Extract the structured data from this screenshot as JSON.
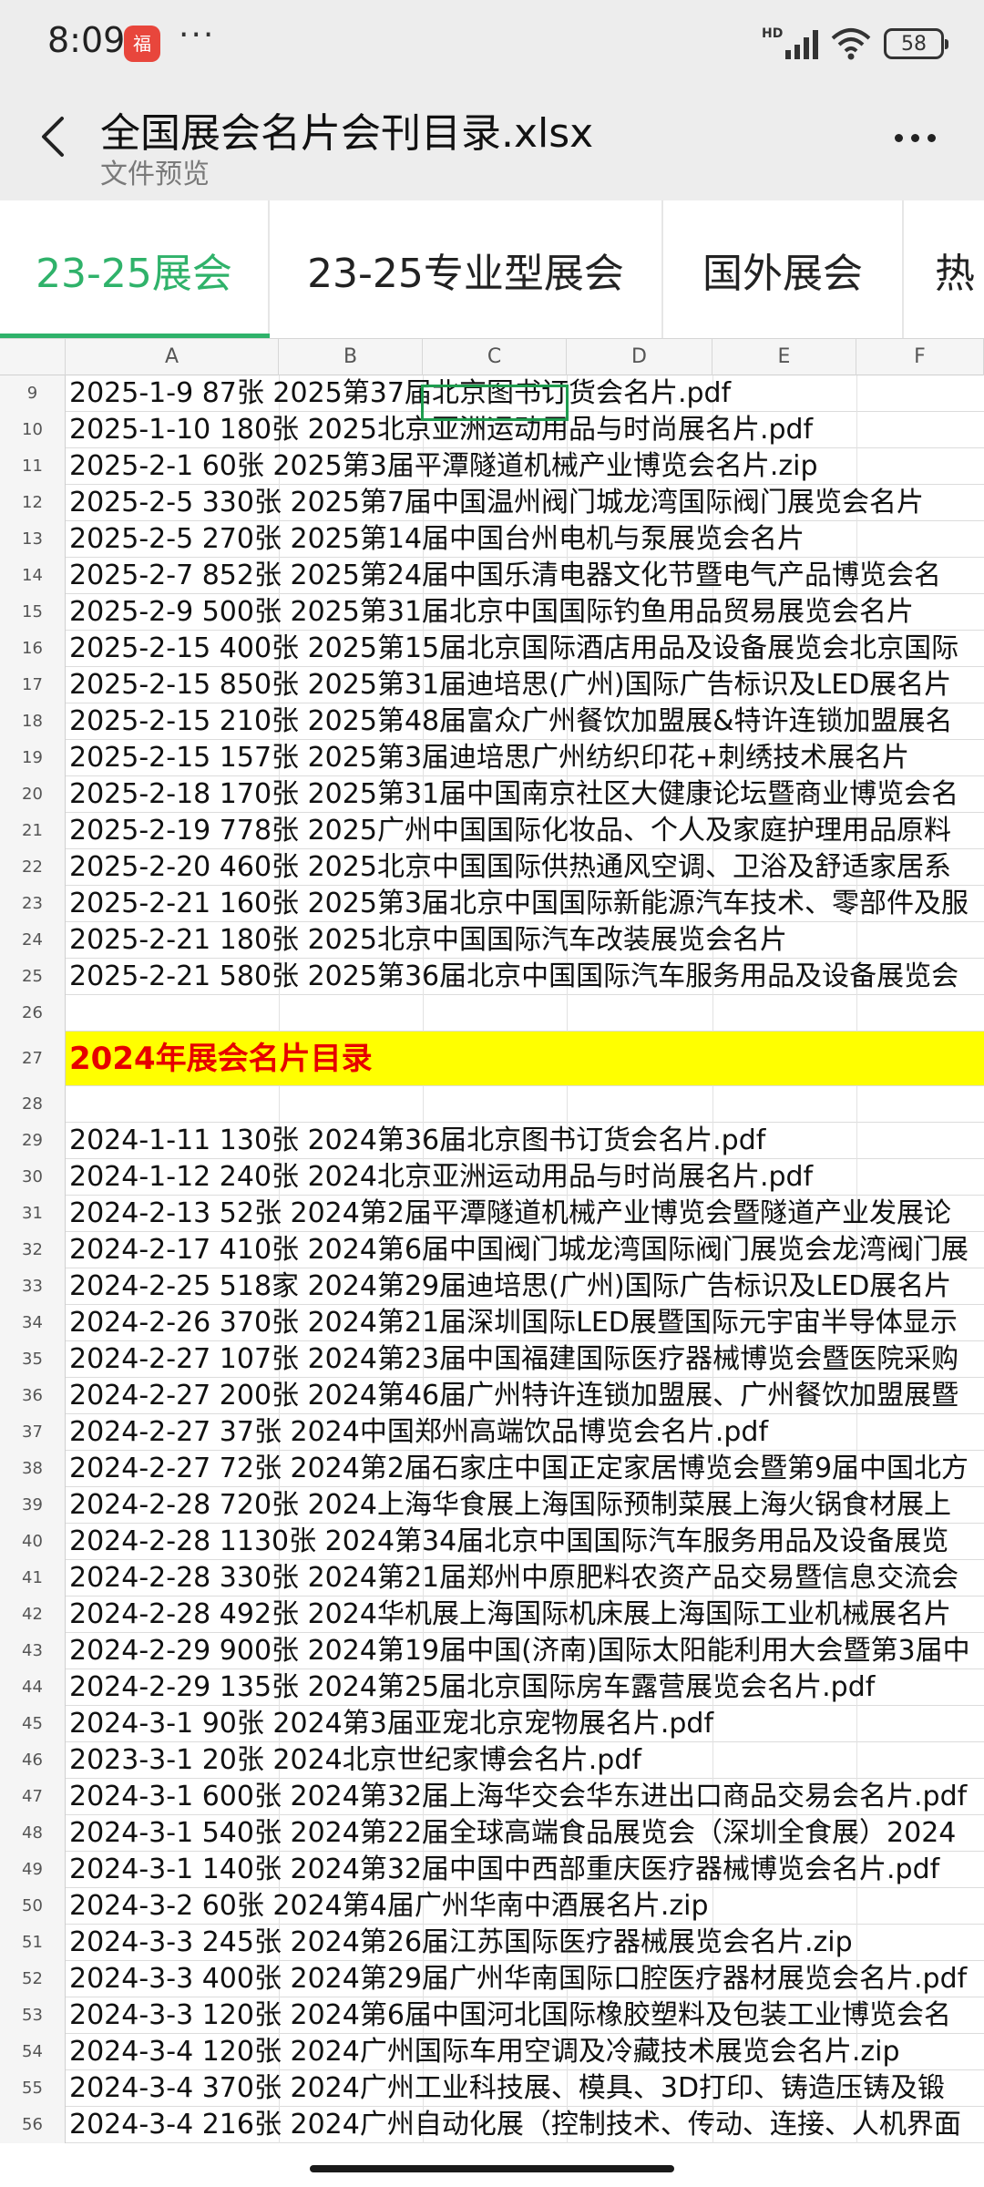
{
  "status": {
    "time": "8:09",
    "app_badge": "福",
    "dots": "···",
    "hd": "HD",
    "battery": "58"
  },
  "header": {
    "title": "全国展会名片会刊目录.xlsx",
    "subtitle": "文件预览"
  },
  "tabs": [
    {
      "label": "23-25展会",
      "active": true
    },
    {
      "label": "23-25专业型展会"
    },
    {
      "label": "国外展会"
    },
    {
      "label": "热"
    }
  ],
  "columns": [
    "A",
    "B",
    "C",
    "D",
    "E",
    "F"
  ],
  "rows": [
    {
      "n": "9",
      "text": "2025-1-9 87张 2025第37届北京图书订货会名片.pdf"
    },
    {
      "n": "10",
      "text": "2025-1-10 180张 2025北京亚洲运动用品与时尚展名片.pdf"
    },
    {
      "n": "11",
      "text": "2025-2-1 60张 2025第3届平潭隧道机械产业博览会名片.zip"
    },
    {
      "n": "12",
      "text": "2025-2-5 330张 2025第7届中国温州阀门城龙湾国际阀门展览会名片"
    },
    {
      "n": "13",
      "text": "2025-2-5 270张 2025第14届中国台州电机与泵展览会名片"
    },
    {
      "n": "14",
      "text": "2025-2-7 852张 2025第24届中国乐清电器文化节暨电气产品博览会名"
    },
    {
      "n": "15",
      "text": "2025-2-9 500张 2025第31届北京中国国际钓鱼用品贸易展览会名片"
    },
    {
      "n": "16",
      "text": "2025-2-15 400张 2025第15届北京国际酒店用品及设备展览会北京国际"
    },
    {
      "n": "17",
      "text": "2025-2-15 850张 2025第31届迪培思(广州)国际广告标识及LED展名片"
    },
    {
      "n": "18",
      "text": "2025-2-15 210张 2025第48届富众广州餐饮加盟展&特许连锁加盟展名"
    },
    {
      "n": "19",
      "text": "2025-2-15 157张 2025第3届迪培思广州纺织印花+刺绣技术展名片"
    },
    {
      "n": "20",
      "text": "2025-2-18 170张 2025第31届中国南京社区大健康论坛暨商业博览会名"
    },
    {
      "n": "21",
      "text": "2025-2-19 778张 2025广州中国国际化妆品、个人及家庭护理用品原料"
    },
    {
      "n": "22",
      "text": "2025-2-20 460张 2025北京中国国际供热通风空调、卫浴及舒适家居系"
    },
    {
      "n": "23",
      "text": "2025-2-21 160张 2025第3届北京中国国际新能源汽车技术、零部件及服"
    },
    {
      "n": "24",
      "text": "2025-2-21 180张 2025北京中国国际汽车改装展览会名片"
    },
    {
      "n": "25",
      "text": "2025-2-21 580张 2025第36届北京中国国际汽车服务用品及设备展览会"
    },
    {
      "n": "26",
      "text": ""
    },
    {
      "n": "27",
      "text": "2024年展会名片目录",
      "highlight": true
    },
    {
      "n": "28",
      "text": ""
    },
    {
      "n": "29",
      "text": "2024-1-11 130张 2024第36届北京图书订货会名片.pdf"
    },
    {
      "n": "30",
      "text": "2024-1-12 240张 2024北京亚洲运动用品与时尚展名片.pdf"
    },
    {
      "n": "31",
      "text": "2024-2-13 52张 2024第2届平潭隧道机械产业博览会暨隧道产业发展论"
    },
    {
      "n": "32",
      "text": "2024-2-17 410张 2024第6届中国阀门城龙湾国际阀门展览会龙湾阀门展"
    },
    {
      "n": "33",
      "text": "2024-2-25 518家 2024第29届迪培思(广州)国际广告标识及LED展名片"
    },
    {
      "n": "34",
      "text": "2024-2-26 370张 2024第21届深圳国际LED展暨国际元宇宙半导体显示"
    },
    {
      "n": "35",
      "text": "2024-2-27 107张 2024第23届中国福建国际医疗器械博览会暨医院采购"
    },
    {
      "n": "36",
      "text": "2024-2-27 200张 2024第46届广州特许连锁加盟展、广州餐饮加盟展暨"
    },
    {
      "n": "37",
      "text": "2024-2-27 37张 2024中国郑州高端饮品博览会名片.pdf"
    },
    {
      "n": "38",
      "text": "2024-2-27 72张 2024第2届石家庄中国正定家居博览会暨第9届中国北方"
    },
    {
      "n": "39",
      "text": "2024-2-28 720张 2024上海华食展上海国际预制菜展上海火锅食材展上"
    },
    {
      "n": "40",
      "text": "2024-2-28 1130张 2024第34届北京中国国际汽车服务用品及设备展览"
    },
    {
      "n": "41",
      "text": "2024-2-28 330张 2024第21届郑州中原肥料农资产品交易暨信息交流会"
    },
    {
      "n": "42",
      "text": "2024-2-28 492张 2024华机展上海国际机床展上海国际工业机械展名片"
    },
    {
      "n": "43",
      "text": "2024-2-29 900张 2024第19届中国(济南)国际太阳能利用大会暨第3届中"
    },
    {
      "n": "44",
      "text": "2024-2-29 135张 2024第25届北京国际房车露营展览会名片.pdf"
    },
    {
      "n": "45",
      "text": "2024-3-1 90张 2024第3届亚宠北京宠物展名片.pdf"
    },
    {
      "n": "46",
      "text": "2023-3-1 20张 2024北京世纪家博会名片.pdf"
    },
    {
      "n": "47",
      "text": "2024-3-1 600张 2024第32届上海华交会华东进出口商品交易会名片.pdf"
    },
    {
      "n": "48",
      "text": "2024-3-1 540张 2024第22届全球高端食品展览会（深圳全食展）2024"
    },
    {
      "n": "49",
      "text": "2024-3-1 140张 2024第32届中国中西部重庆医疗器械博览会名片.pdf"
    },
    {
      "n": "50",
      "text": "2024-3-2 60张 2024第4届广州华南中酒展名片.zip"
    },
    {
      "n": "51",
      "text": "2024-3-3 245张 2024第26届江苏国际医疗器械展览会名片.zip"
    },
    {
      "n": "52",
      "text": "2024-3-3 400张 2024第29届广州华南国际口腔医疗器材展览会名片.pdf"
    },
    {
      "n": "53",
      "text": "2024-3-3 120张 2024第6届中国河北国际橡胶塑料及包装工业博览会名"
    },
    {
      "n": "54",
      "text": "2024-3-4 120张 2024广州国际车用空调及冷藏技术展览会名片.zip"
    },
    {
      "n": "55",
      "text": "2024-3-4 370张 2024广州工业科技展、模具、3D打印、铸造压铸及锻"
    },
    {
      "n": "56",
      "text": "2024-3-4 216张 2024广州自动化展（控制技术、传动、连接、人机界面"
    }
  ]
}
